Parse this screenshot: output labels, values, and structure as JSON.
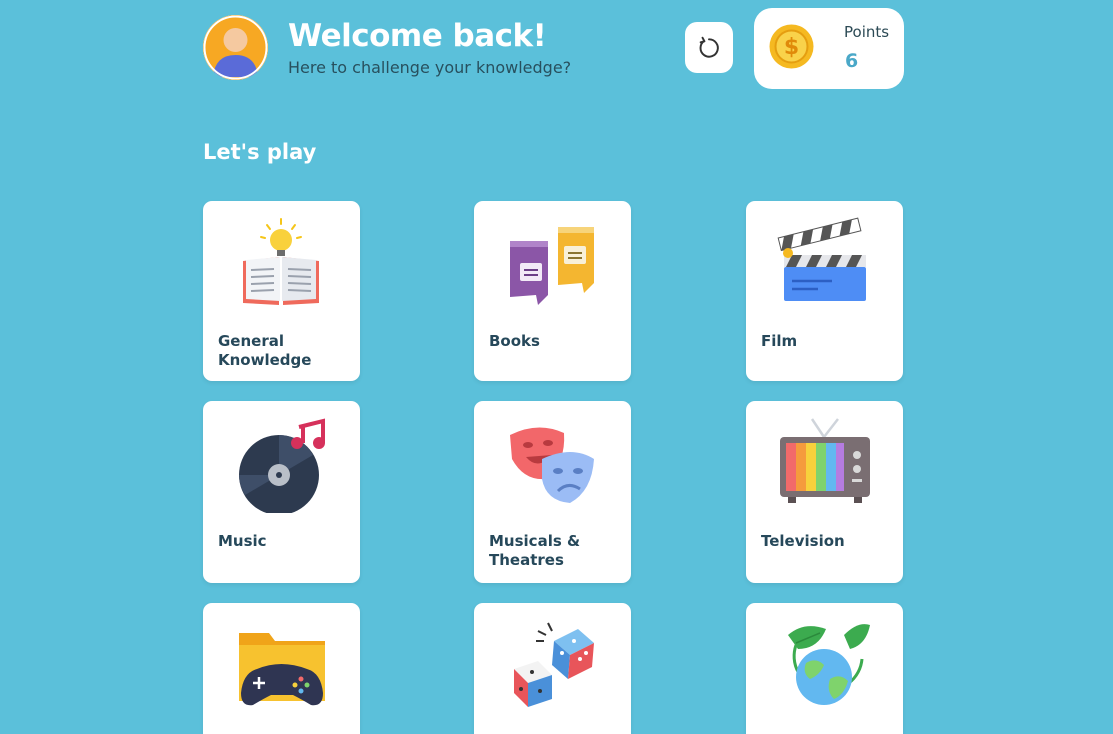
{
  "header": {
    "welcome": "Welcome back!",
    "subtitle": "Here to challenge your knowledge?"
  },
  "points": {
    "label": "Points",
    "value": "6"
  },
  "section_title": "Let's play",
  "categories": [
    {
      "label": "General Knowledge",
      "icon": "open-book-lightbulb-icon"
    },
    {
      "label": "Books",
      "icon": "books-icon"
    },
    {
      "label": "Film",
      "icon": "clapperboard-icon"
    },
    {
      "label": "Music",
      "icon": "vinyl-record-icon"
    },
    {
      "label": "Musicals & Theatres",
      "icon": "theatre-masks-icon"
    },
    {
      "label": "Television",
      "icon": "tv-icon"
    },
    {
      "label": "",
      "icon": "game-controller-folder-icon"
    },
    {
      "label": "",
      "icon": "dice-icon"
    },
    {
      "label": "",
      "icon": "globe-leaves-icon"
    }
  ],
  "colors": {
    "background": "#5bc0da",
    "card": "#ffffff",
    "text_dark": "#26485a",
    "points_value": "#4aa8c8"
  }
}
